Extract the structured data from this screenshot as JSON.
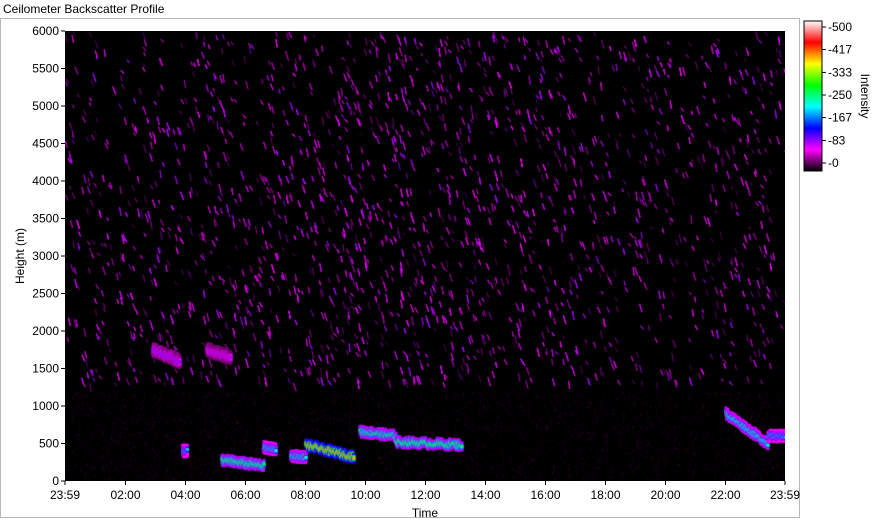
{
  "window": {
    "title": "Ceilometer Backscatter Profile"
  },
  "chart_data": {
    "type": "heatmap",
    "title": "",
    "xlabel": "Time",
    "ylabel": "Height (m)",
    "x_ticks": [
      "23:59",
      "02:00",
      "04:00",
      "06:00",
      "08:00",
      "10:00",
      "12:00",
      "14:00",
      "16:00",
      "18:00",
      "20:00",
      "22:00",
      "23:59"
    ],
    "xlim_hours": [
      -0.017,
      23.983
    ],
    "y_ticks": [
      0,
      500,
      1000,
      1500,
      2000,
      2500,
      3000,
      3500,
      4000,
      4500,
      5000,
      5500,
      6000
    ],
    "ylim": [
      0,
      6000
    ],
    "colorbar": {
      "label": "Intensity",
      "ticks": [
        500,
        417,
        333,
        250,
        167,
        83,
        0
      ],
      "range": [
        0,
        500
      ],
      "colors": [
        "#000000",
        "#ff00ff",
        "#0000ff",
        "#00ffff",
        "#00ff00",
        "#ffff00",
        "#ff0000",
        "#ffffff"
      ]
    },
    "features": [
      {
        "name": "cloud",
        "t_start": 2.9,
        "t_end": 3.8,
        "h_start": 1750,
        "h_end": 1600,
        "intensity": 110
      },
      {
        "name": "cloud",
        "t_start": 4.7,
        "t_end": 5.5,
        "h_start": 1750,
        "h_end": 1650,
        "intensity": 95
      },
      {
        "name": "boundary layer",
        "t_start": 3.9,
        "t_end": 4.05,
        "h_start": 400,
        "h_end": 400,
        "intensity": 200
      },
      {
        "name": "boundary layer",
        "t_start": 5.2,
        "t_end": 6.6,
        "h_start": 280,
        "h_end": 200,
        "intensity": 260
      },
      {
        "name": "boundary layer",
        "t_start": 6.6,
        "t_end": 7.0,
        "h_start": 450,
        "h_end": 420,
        "intensity": 220
      },
      {
        "name": "boundary layer",
        "t_start": 7.5,
        "t_end": 8.0,
        "h_start": 330,
        "h_end": 320,
        "intensity": 230
      },
      {
        "name": "boundary layer",
        "t_start": 8.0,
        "t_end": 9.6,
        "h_start": 480,
        "h_end": 320,
        "intensity": 380
      },
      {
        "name": "boundary layer",
        "t_start": 9.8,
        "t_end": 11.0,
        "h_start": 660,
        "h_end": 600,
        "intensity": 250
      },
      {
        "name": "boundary layer",
        "t_start": 11.0,
        "t_end": 13.2,
        "h_start": 520,
        "h_end": 480,
        "intensity": 260
      },
      {
        "name": "boundary layer",
        "t_start": 22.0,
        "t_end": 23.4,
        "h_start": 900,
        "h_end": 500,
        "intensity": 230
      },
      {
        "name": "boundary layer",
        "t_start": 23.4,
        "t_end": 23.98,
        "h_start": 600,
        "h_end": 600,
        "intensity": 200
      }
    ]
  }
}
